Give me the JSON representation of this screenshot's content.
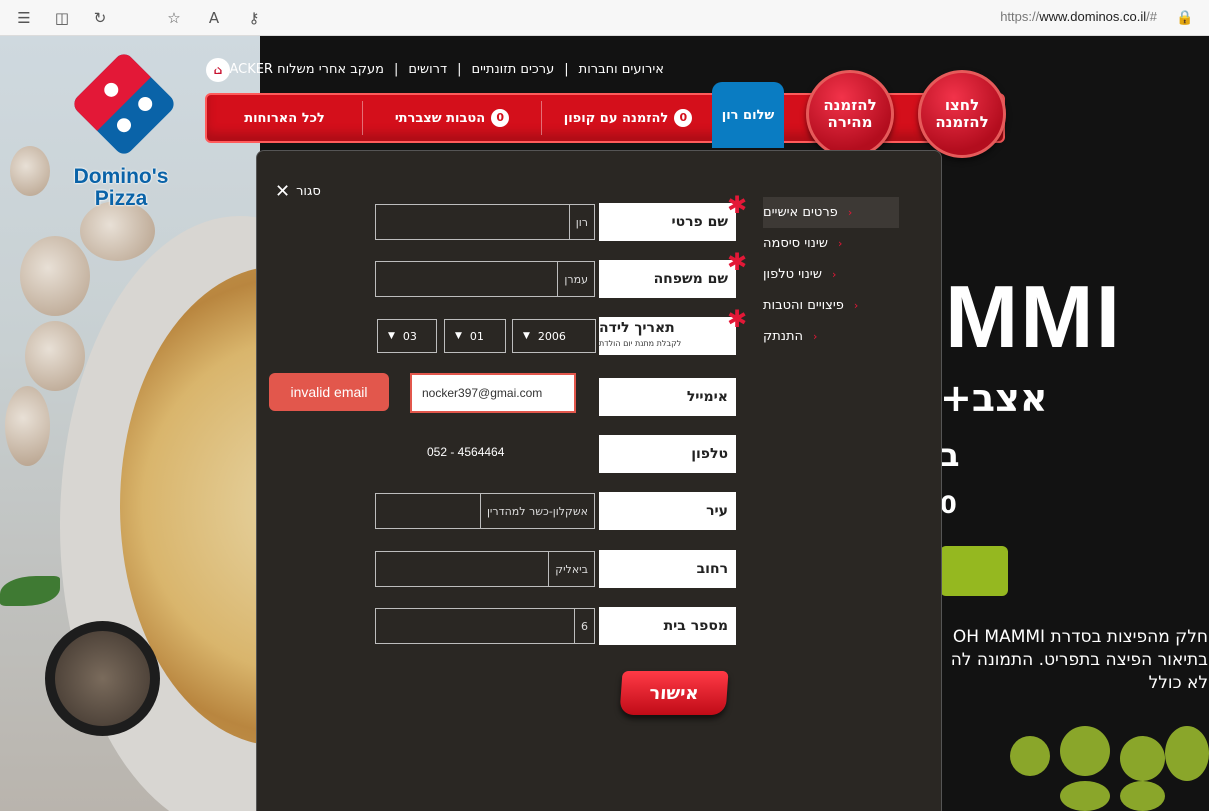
{
  "browser": {
    "url_prefix": "https://",
    "url_domain": "www.dominos.co.il",
    "url_suffix": "/#"
  },
  "brand": {
    "logo_line1": "Domino's",
    "logo_line2": "Pizza"
  },
  "top_links": {
    "tracker": "מעקב אחרי משלוח TRACKER",
    "jobs": "דרושים",
    "nutrition": "ערכים תזונתיים",
    "events": "אירועים וחברות"
  },
  "nav": {
    "all_meals": "לכל הארוחות",
    "accumulated_benefits": "הטבות שצברתי",
    "accumulated_count": "0",
    "coupon_order": "להזמנה עם קופון",
    "coupon_count": "0",
    "user_greeting": "שלום רון",
    "quick_order": "להזמנה מהירה",
    "click_to_order": "לחצו להזמנה"
  },
  "promo": {
    "big_text": "MMI",
    "line1": "+אצב",
    "line2": "ב",
    "line3": "0",
    "desc_line1": "חלק מהפיצות בסדרת OH MAMMI",
    "desc_line2": "בתיאור הפיצה בתפריט. התמונה לה",
    "desc_line3": "לא כולל"
  },
  "modal": {
    "close_label": "סגור",
    "side_menu": [
      {
        "label": "פרטים אישיים",
        "active": true
      },
      {
        "label": "שינוי סיסמה",
        "active": false
      },
      {
        "label": "שינוי טלפון",
        "active": false
      },
      {
        "label": "פיצויים והטבות",
        "active": false
      },
      {
        "label": "התנתק",
        "active": false
      }
    ],
    "fields": {
      "first_name": {
        "label": "שם פרטי",
        "value": "רון"
      },
      "last_name": {
        "label": "שם משפחה",
        "value": "עמרן"
      },
      "birth_date": {
        "label": "תאריך לידה",
        "sublabel": "לקבלת מתנת יום הולדת",
        "year": "2006",
        "month": "01",
        "day": "03"
      },
      "email": {
        "label": "אימייל",
        "value": "nocker397@gmai.com",
        "error": "invalid email"
      },
      "phone": {
        "label": "טלפון",
        "value": "052 - 4564464"
      },
      "city": {
        "label": "עיר",
        "value": "אשקלון-כשר למהדרין"
      },
      "street": {
        "label": "רחוב",
        "value": "ביאליק"
      },
      "house_number": {
        "label": "מספר בית",
        "value": "6"
      }
    },
    "submit_label": "אישור"
  },
  "colors": {
    "brand_red": "#d40f1b",
    "brand_blue": "#0a63a8",
    "error": "#e2574c"
  }
}
